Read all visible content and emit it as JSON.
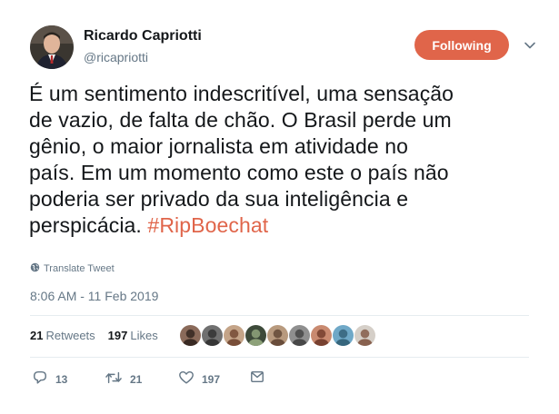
{
  "author": {
    "display_name": "Ricardo Capriotti",
    "handle": "@ricapriotti"
  },
  "follow_button": {
    "label": "Following",
    "color": "#e0654a"
  },
  "tweet": {
    "lines": [
      "É um sentimento indescritível, uma sensação",
      "de vazio, de falta de chão. O Brasil perde um",
      "gênio, o maior jornalista em atividade no",
      "país. Em um momento como este o país não",
      "poderia ser privado da sua inteligência e"
    ],
    "last_line_text": "perspicácia. ",
    "hashtag": "#RipBoechat",
    "hashtag_color": "#e0654a"
  },
  "translate_label": "Translate Tweet",
  "timestamp": "8:06 AM - 11 Feb 2019",
  "stats": {
    "retweets_count": "21",
    "retweets_label": "Retweets",
    "likes_count": "197",
    "likes_label": "Likes"
  },
  "likers": [
    {
      "name": "liker-avatar-1",
      "bg": "#8a6a5a",
      "fg": "#2a1f1a"
    },
    {
      "name": "liker-avatar-2",
      "bg": "#707070",
      "fg": "#2b2b2b"
    },
    {
      "name": "liker-avatar-3",
      "bg": "#c4a488",
      "fg": "#6b3f2a"
    },
    {
      "name": "liker-avatar-4",
      "bg": "#3d4a3a",
      "fg": "#9bb085"
    },
    {
      "name": "liker-avatar-5",
      "bg": "#b89a7e",
      "fg": "#5a3f2f"
    },
    {
      "name": "liker-avatar-6",
      "bg": "#8f8f8f",
      "fg": "#3c3c3c"
    },
    {
      "name": "liker-avatar-7",
      "bg": "#c98a70",
      "fg": "#6a3424"
    },
    {
      "name": "liker-avatar-8",
      "bg": "#6fa8c7",
      "fg": "#2d5a70"
    },
    {
      "name": "liker-avatar-9",
      "bg": "#d5cfc8",
      "fg": "#7a4e3a"
    }
  ],
  "actions": {
    "replies": "13",
    "retweets": "21",
    "likes": "197"
  },
  "icons": {
    "caret": "chevron-down-icon",
    "translate": "globe-icon",
    "reply": "reply-icon",
    "retweet": "retweet-icon",
    "like": "heart-icon",
    "dm": "envelope-icon"
  }
}
